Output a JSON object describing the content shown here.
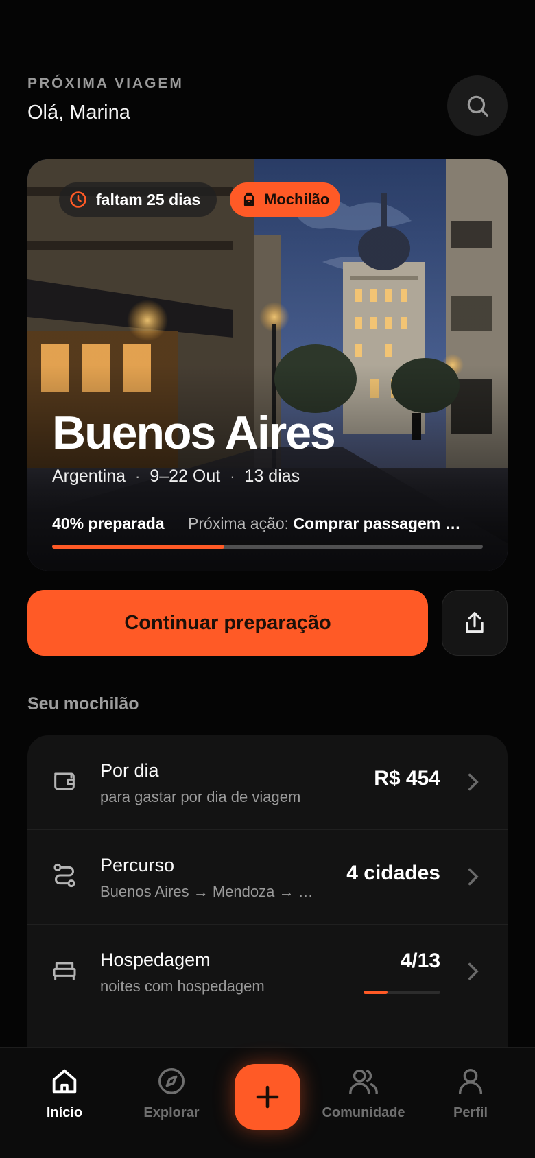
{
  "header": {
    "eyebrow": "PRÓXIMA VIAGEM",
    "greeting": "Olá, Marina"
  },
  "hero": {
    "countdown": "faltam 25 dias",
    "badge": "Mochilão",
    "city": "Buenos Aires",
    "country": "Argentina",
    "dates": "9–22 Out",
    "duration": "13 dias",
    "progress_label": "40% preparada",
    "progress": 0.4,
    "next_label": "Próxima ação:",
    "next_action": "Comprar passagem …"
  },
  "cta": {
    "label": "Continuar preparação"
  },
  "section": {
    "title": "Seu mochilão"
  },
  "items": [
    {
      "title": "Por dia",
      "subtitle": "para gastar por dia de viagem",
      "value": "R$ 454",
      "icon": "wallet-icon"
    },
    {
      "title": "Percurso",
      "subtitle": "Buenos Aires → Mendoza → …",
      "value": "4 cidades",
      "icon": "route-icon"
    },
    {
      "title": "Hospedagem",
      "subtitle": "noites com hospedagem",
      "value": "4/13",
      "progress": 0.31,
      "icon": "bed-icon"
    }
  ],
  "nav": [
    {
      "label": "Início",
      "icon": "home-icon",
      "active": true
    },
    {
      "label": "Explorar",
      "icon": "compass-icon"
    },
    {
      "label": "Comunidade",
      "icon": "community-icon"
    },
    {
      "label": "Perfil",
      "icon": "user-icon"
    }
  ],
  "colors": {
    "accent": "#ff5a26",
    "background": "#050505",
    "card": "#131313"
  }
}
